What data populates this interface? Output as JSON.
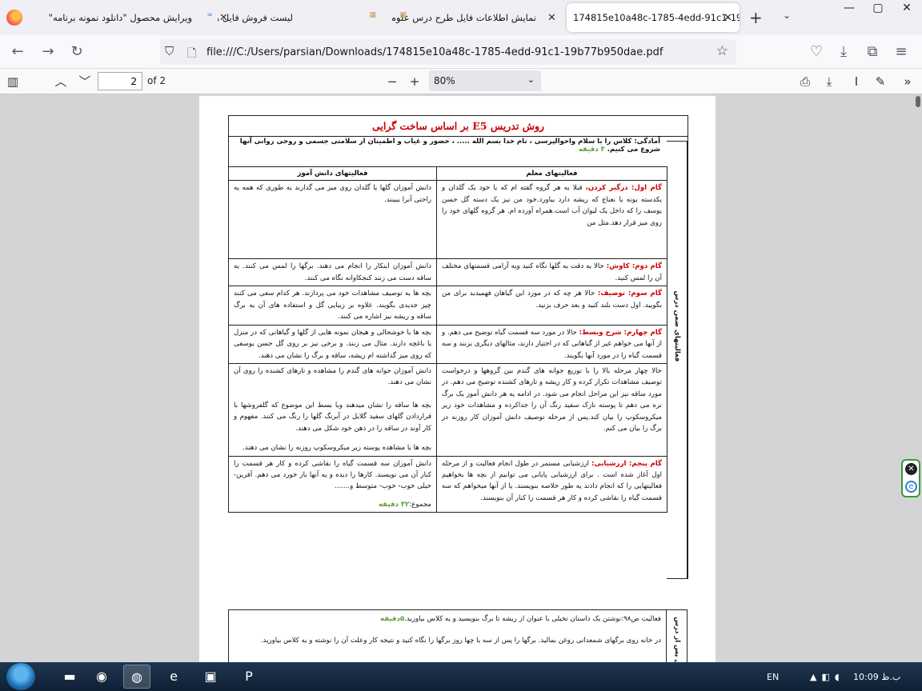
{
  "browser": {
    "tabs": [
      {
        "label": "ویرایش محصول \"دانلود نمونه برنامه\"",
        "active": false
      },
      {
        "label": "لیست فروش فایل ها",
        "active": false
      },
      {
        "label": "نمایش اطلاعات فایل طرح درس علوم",
        "active": false
      },
      {
        "label": "174815e10a48c-1785-4edd-91c1-19b",
        "active": true
      }
    ],
    "close_glyph": "✕",
    "new_tab_glyph": "+",
    "list_tabs_glyph": "⌄",
    "window_controls": {
      "minimize": "—",
      "maximize": "▢",
      "close": "✕"
    },
    "url": "file:///C:/Users/parsian/Downloads/174815e10a48c-1785-4edd-91c1-19b77b950dae.pdf"
  },
  "pdf_toolbar": {
    "current_page": "2",
    "total_pages_label": "of 2",
    "zoom": "80%"
  },
  "document": {
    "title": "روش تدریس  E5 بر اساس ساخت گرایی",
    "prep_text": "آمادگی:  کلاس را با سلام  واحوالپرسی ، نام خدا بسم الله  ..... ، حضور و غیاب  و اطمینان از سلامتی جسمی و روحی روانی آنها شروع  می کنیم.",
    "prep_time": "  ۳ دقیقه",
    "header_teacher": "فعالیتهای معلم",
    "header_student": "فعالیتهای دانش آموز",
    "side_label_1": "فعالیتهای ضمن درس",
    "side_label_2": "فعالیتهای پس از درس",
    "rows": [
      {
        "step": "گام اول: درگیر کردن،",
        "teacher": " قبلا یه هر  گروه گفته ام که  یا خود یک گلدان و یکدسته یونه یا نعناع که ریشه دارد بیاورد.خود من نیز یک دسته گل حسن یوسف را که داخل یک لیوان آب است.همراه آورده ام. هر گروه گلهای خود را روی میز قرار دهد.مثل من",
        "student": "دانش آموزان گلها یا گلدان روی میز می گذارند یه طوری که همه یه راحتی آنرا ببینند."
      },
      {
        "step": "گام دوم: کاوش:",
        "teacher": " حالا یه دقت یه گلها نگاه کنید ویه آرامی قسمتهای مختلف آن را لمس کنید.",
        "student": "دانش آموزان اینکار را انجام می دهند. برگها را لمس می کنند. یه ساقه دست می زنند کنجکاوانه نگاه می کنند."
      },
      {
        "step": "گام سوم: توصیف:",
        "teacher": " حالا هر چه که در مورد این گیاهان فهمیدید برای من بگویید. اول دست بلند کنید و بعد حرف بزنید.",
        "student": "بچه ها یه توصیف مشاهدات خود می پردازند. هر کدام سعی می کنند چیز جدیدی بگویند. علاوه بر زیبایی گل و استفاده های آن یه برگ ساقه و ریشه نیز اشاره می کنند."
      },
      {
        "step": "گام چهارم: شرح وبسط:",
        "teacher": " حالا در مورد سه قسمت گیاه توضیح می دهم. و از آنها می خواهم غیر از گیاهانی که در اختیار دارند، مثالهای دیگری بزنند و سه قسمت گیاه را در مورد آنها بگویند.",
        "student": "بچه ها با خوشحالی و هیجان نمونه هایی از گلها و گیاهانی که در منزل یا باغچه دارند. مثال می زنند. و برخی نیز بر روی گل حسن یوسفی که روی میز گذاشته ام ریشه، ساقه و برگ را نشان می دهند."
      },
      {
        "step": "",
        "teacher": "حالا چهار مرحله بالا را با توزیع جوانه های گندم بین گروهها و درخواست توصیف مشاهدات تکرار کرده و کار ریشه و تارهای کشنده توضیح می دهم. در مورد ساقه نیز این مراحل انجام می شود. در ادامه یه هر دانش آموز یک برگ نره می دهم تا پوسته نازک سفید رنگ آن را جداکرده و مشاهدات خود زیر میکروسکوپ را بیان کند.پس از مرحله توصیف دانش آموزان کار روزنه در برگ را بیان می کنم.",
        "student": "دانش آموزان جوانه های گندم را مشاهده و تارهای کشنده را روی آن نشان می دهند.",
        "student2": "بچه ها ساقه را نشان میدهند وبا بسط این موضوع که گلفروشها با قراردادن گلهای سفید گلایل در آبرنگ گلها را رنگ می کنند. مفهوم و کار آوند در ساقه را در ذهن خود شکل می دهند.",
        "student3": "بچه ها با مشاهده پوسته زیر میکروسکوپ روزنه را نشان می دهند."
      },
      {
        "step": "گام پنجم: ارزشیابی:",
        "teacher": " ارزشیابی مستمر در طول انجام فعالیت و از مرحله اول آغاز شده است . برای ارزشیابی پایانی می توانیم از بچه ها بخواهیم فعالیتهایی را که انجام دادند یه طور خلاصه بنویسند. یا از آنها میخواهم که سه قسمت گیاه را نقاشی کرده و کار هر قسمت را کنار آن بنویسند.",
        "student": "دانش آموزان سه قسمت گیاه را نقاشی کرده و کار هر قسمت را کنار آن می نویسند. کارها را دیده و یه آنها باز خورد می دهم. آفرین-خیلی خوب- خوب- متوسط و.......",
        "total_label": "مجموع:",
        "total_time": "۳۲ دقیقه"
      }
    ],
    "after_line1": "فعالیت ص۹۸:نوشتن یک داستان تخیلی با عنوان از ریشه تا برگ بنویسید و یه کلاس بیاورید.",
    "after_time": "۵دقیقه",
    "after_line2": "در خانه روی برگهای شمعدانی روغن بمالید. برگها را پس از سه یا چها روز برگها را نگاه کنید و نتیجه کار وعلت آن را نوشته و یه کلاس بیاورید."
  },
  "taskbar": {
    "language": "EN",
    "clock": "ب.ظ 10:09"
  },
  "colors": {
    "step_red": "#cc0000",
    "time_green": "#5b9b3a",
    "taskbar": "#1f3650"
  }
}
